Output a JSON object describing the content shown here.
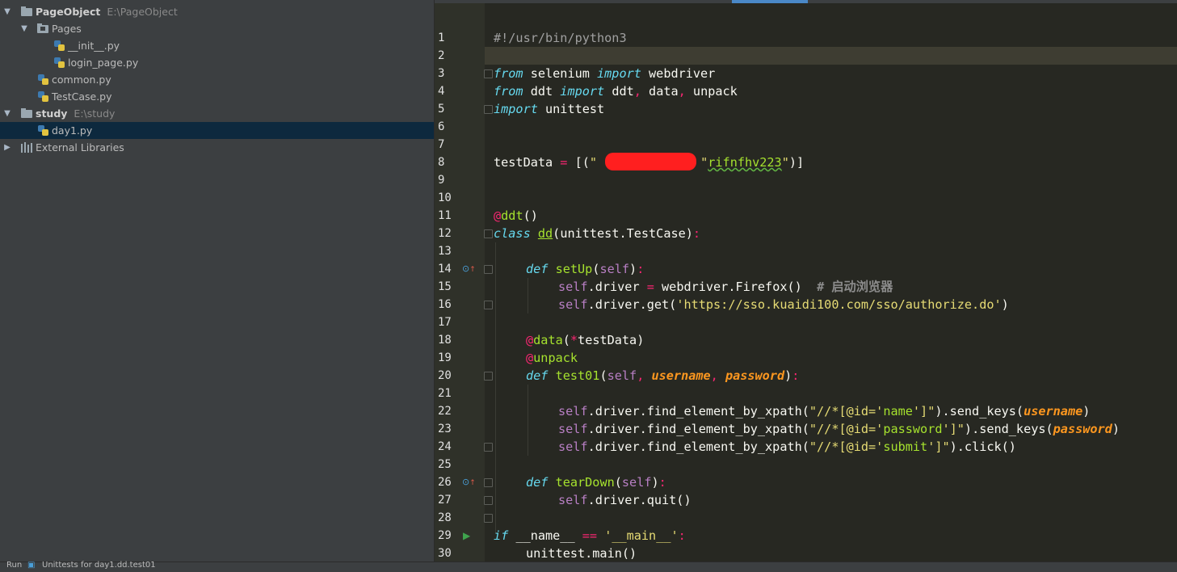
{
  "project_tree": {
    "items": [
      {
        "label": "PageObject",
        "path": "E:\\PageObject",
        "kind": "root"
      },
      {
        "label": "Pages",
        "kind": "package"
      },
      {
        "label": "__init__.py",
        "kind": "python-file"
      },
      {
        "label": "login_page.py",
        "kind": "python-file"
      },
      {
        "label": "common.py",
        "kind": "python-file"
      },
      {
        "label": "TestCase.py",
        "kind": "python-file"
      },
      {
        "label": "study",
        "path": "E:\\study",
        "kind": "root"
      },
      {
        "label": "day1.py",
        "kind": "python-file",
        "selected": true
      },
      {
        "label": "External Libraries",
        "kind": "libraries"
      }
    ]
  },
  "editor": {
    "line_numbers": [
      "1",
      "2",
      "3",
      "4",
      "5",
      "6",
      "7",
      "8",
      "9",
      "10",
      "11",
      "12",
      "13",
      "14",
      "15",
      "16",
      "17",
      "18",
      "19",
      "20",
      "21",
      "22",
      "23",
      "24",
      "25",
      "26",
      "27",
      "28",
      "29",
      "30"
    ],
    "current_line": 2,
    "code": {
      "l1": "#!/usr/bin/python3",
      "l3_kw1": "from",
      "l3_a": " selenium ",
      "l3_kw2": "import",
      "l3_b": " webdriver",
      "l4_kw1": "from",
      "l4_a": " ddt ",
      "l4_kw2": "import",
      "l4_b": " ddt",
      "l4_c": ",",
      "l4_d": " data",
      "l4_e": ",",
      "l4_f": " unpack",
      "l5_kw": "import",
      "l5_a": " unittest",
      "l8_a": "testData ",
      "l8_eq": "=",
      "l8_b": " [(",
      "l8_q1": "\"",
      "l8_redacted": "           ",
      "l8_q2": "\"",
      "l8_comma": ",",
      "l8_sp": " ",
      "l8_s2q1": "\"",
      "l8_s2": "rifnfhv223",
      "l8_s2q2": "\"",
      "l8_end": ")]",
      "l11_at": "@",
      "l11_name": "ddt",
      "l11_p": "()",
      "l12_kw": "class",
      "l12_sp": " ",
      "l12_name": "dd",
      "l12_a": "(unittest.TestCase)",
      "l12_colon": ":",
      "l14_kw": "def",
      "l14_sp": " ",
      "l14_name": "setUp",
      "l14_a": "(",
      "l14_self": "self",
      "l14_b": ")",
      "l14_colon": ":",
      "l15_self": "self",
      "l15_a": ".driver ",
      "l15_eq": "=",
      "l15_b": " webdriver.Firefox()  ",
      "l15_cm": "# 启动浏览器",
      "l16_self": "self",
      "l16_a": ".driver.get(",
      "l16_str": "'https://sso.kuaidi100.com/sso/authorize.do'",
      "l16_b": ")",
      "l18_at": "@",
      "l18_name": "data",
      "l18_a": "(",
      "l18_star": "*",
      "l18_b": "testData)",
      "l19_at": "@",
      "l19_name": "unpack",
      "l20_kw": "def",
      "l20_sp": " ",
      "l20_name": "test01",
      "l20_a": "(",
      "l20_self": "self",
      "l20_c1": ", ",
      "l20_p1": "username",
      "l20_c2": ", ",
      "l20_p2": "password",
      "l20_b": ")",
      "l20_colon": ":",
      "l22_self": "self",
      "l22_a": ".driver.find_element_by_xpath(",
      "l22_q": "\"//*[@id='",
      "l22_v": "name",
      "l22_q2": "']\"",
      "l22_b": ").send_keys(",
      "l22_p": "username",
      "l22_c": ")",
      "l23_self": "self",
      "l23_a": ".driver.find_element_by_xpath(",
      "l23_q": "\"//*[@id='",
      "l23_v": "password",
      "l23_q2": "']\"",
      "l23_b": ").send_keys(",
      "l23_p": "password",
      "l23_c": ")",
      "l24_self": "self",
      "l24_a": ".driver.find_element_by_xpath(",
      "l24_q": "\"//*[@id='",
      "l24_v": "submit",
      "l24_q2": "']\"",
      "l24_b": ").click()",
      "l26_kw": "def",
      "l26_sp": " ",
      "l26_name": "tearDown",
      "l26_a": "(",
      "l26_self": "self",
      "l26_b": ")",
      "l26_colon": ":",
      "l27_self": "self",
      "l27_a": ".driver.quit()",
      "l29_kw": "if",
      "l29_a": " __name__ ",
      "l29_eq": "==",
      "l29_sp": " ",
      "l29_str": "'__main__'",
      "l29_colon": ":",
      "l30_a": "unittest.main()"
    }
  },
  "bottom_bar": {
    "run_label": "Run",
    "config_label": "Unittests for day1.dd.test01"
  },
  "colors": {
    "editor_bg": "#272822",
    "panel_bg": "#3c3f41",
    "selection": "#0d293e",
    "keyword": "#66d9ef",
    "operator": "#f92672",
    "string": "#e6db74",
    "function": "#a6e22e"
  }
}
